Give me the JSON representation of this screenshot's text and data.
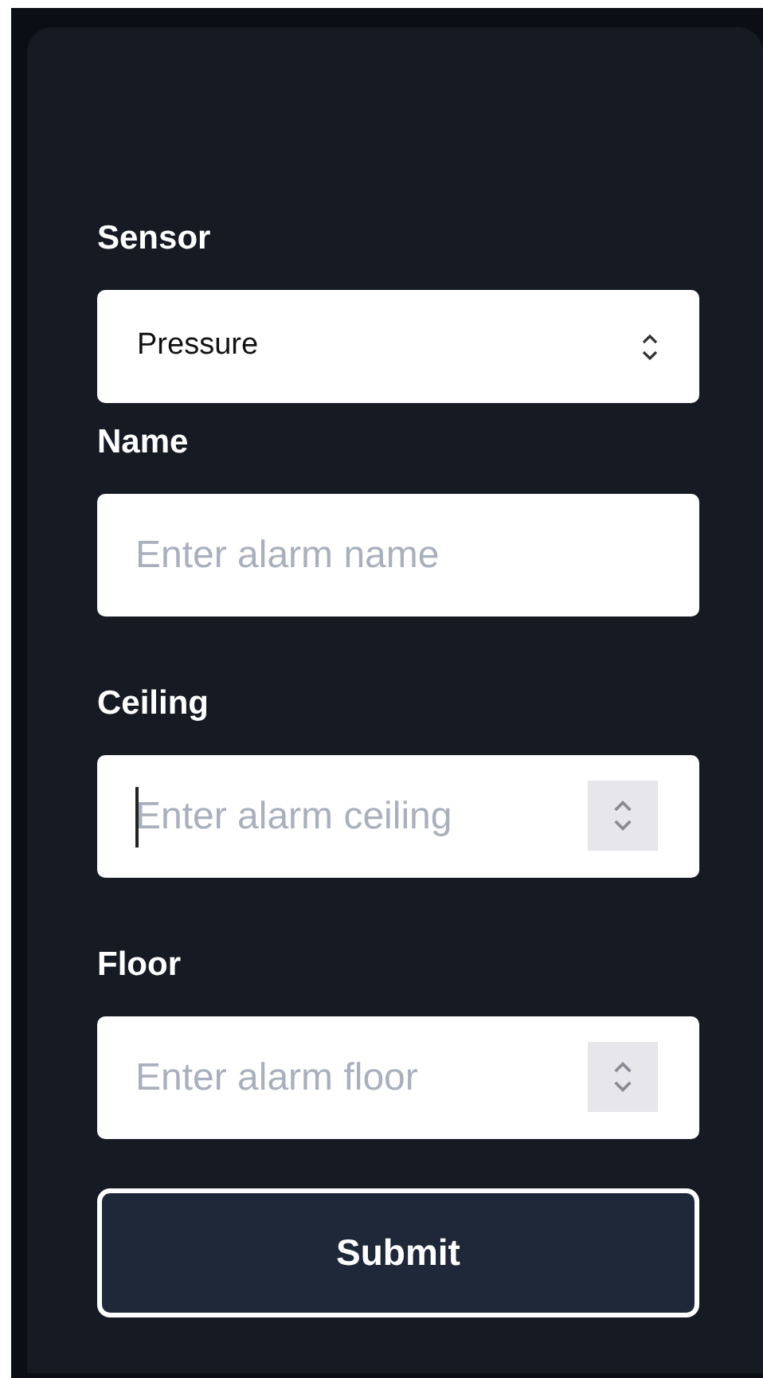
{
  "fields": [
    {
      "kind": "select",
      "label": "Sensor",
      "value": "Pressure"
    },
    {
      "kind": "text",
      "label": "Name",
      "placeholder": "Enter alarm name",
      "focused": false
    },
    {
      "kind": "number",
      "label": "Ceiling",
      "placeholder": "Enter alarm ceiling",
      "focused": true
    },
    {
      "kind": "number",
      "label": "Floor",
      "placeholder": "Enter alarm floor",
      "focused": false
    }
  ],
  "submit_button": "Submit"
}
